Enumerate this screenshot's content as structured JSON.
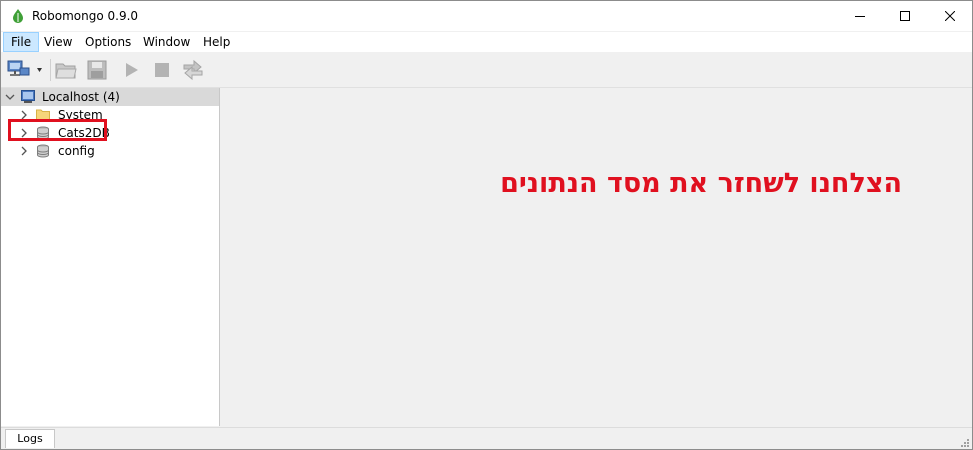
{
  "window": {
    "title": "Robomongo 0.9.0"
  },
  "window_controls": {
    "minimize_icon": "minimize-icon",
    "maximize_icon": "maximize-icon",
    "close_icon": "close-icon"
  },
  "menu": {
    "items": [
      {
        "label": "File"
      },
      {
        "label": "View"
      },
      {
        "label": "Options"
      },
      {
        "label": "Window"
      },
      {
        "label": "Help"
      }
    ]
  },
  "toolbar": {
    "buttons": [
      "connect-icon",
      "open-folder-icon",
      "save-icon",
      "execute-icon",
      "stop-icon",
      "orientation-icon"
    ]
  },
  "explorer": {
    "server": {
      "label": "Localhost (4)"
    },
    "databases": [
      {
        "label": "System",
        "icon": "folder-icon"
      },
      {
        "label": "Cats2DB",
        "icon": "database-icon"
      },
      {
        "label": "config",
        "icon": "database-icon"
      }
    ]
  },
  "annotation": {
    "text": "הצלחנו לשחזר את מסד הנתונים",
    "color": "#e0101f"
  },
  "status": {
    "logs_tab": "Logs"
  },
  "colors": {
    "accent_red": "#e0101f",
    "menu_hover": "#cce8ff"
  }
}
